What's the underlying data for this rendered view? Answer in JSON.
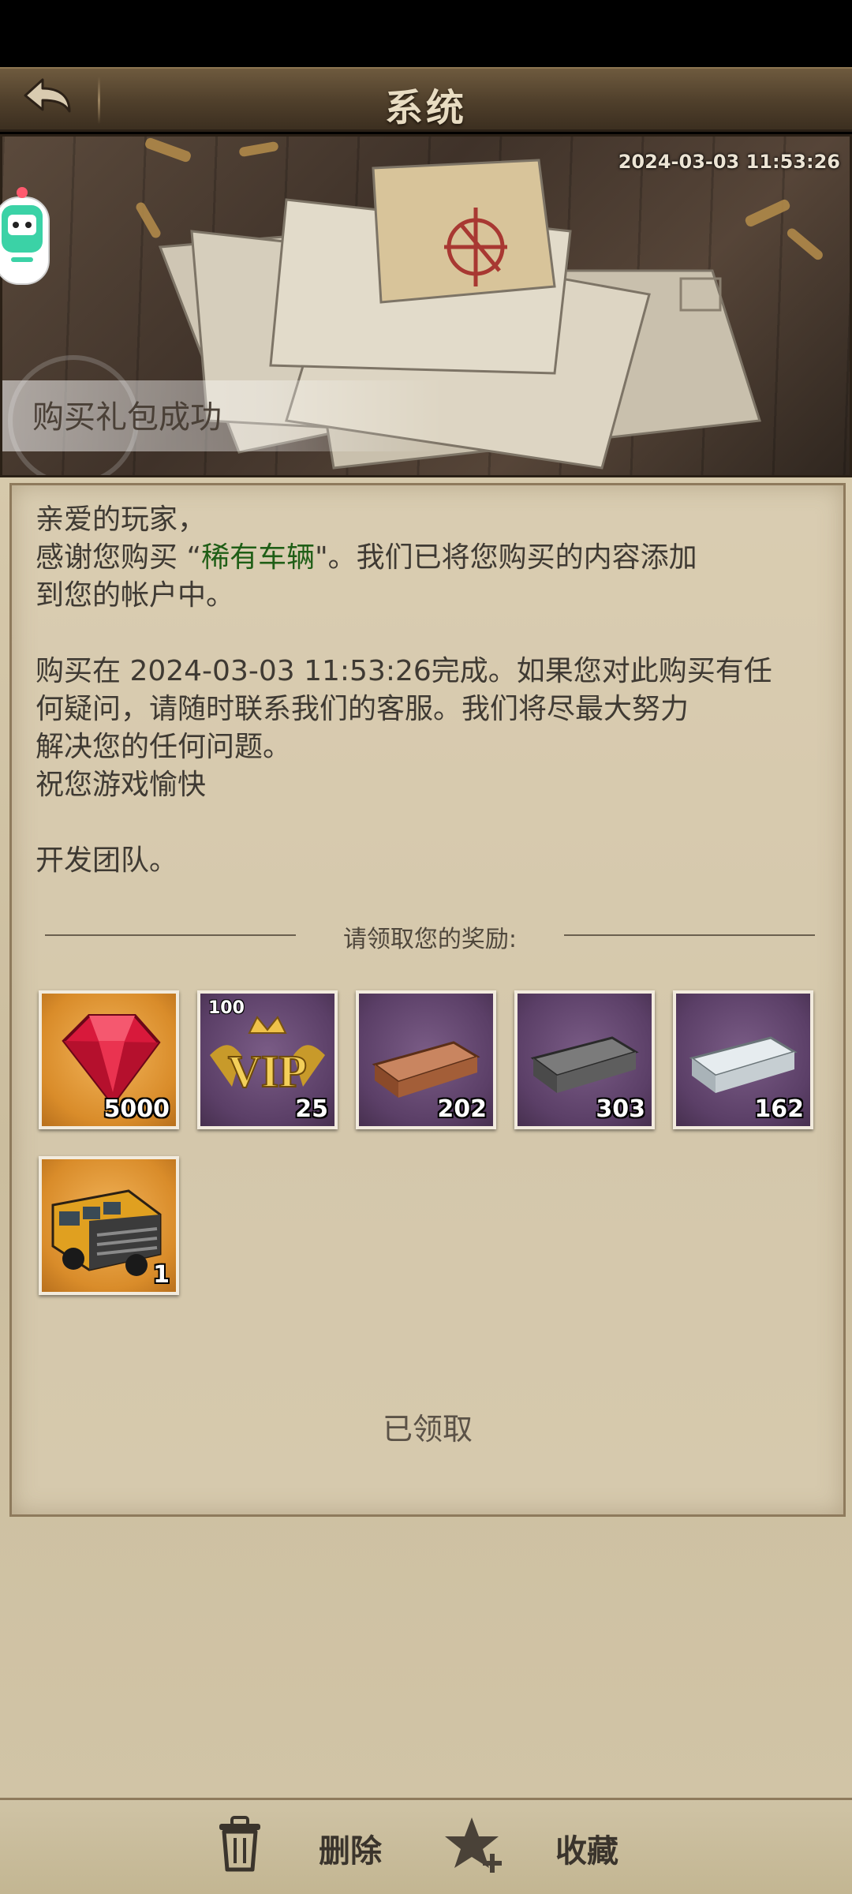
{
  "header": {
    "title": "系统"
  },
  "banner": {
    "timestamp": "2024-03-03 11:53:26",
    "title": "购买礼包成功"
  },
  "letter": {
    "greeting": "亲爱的玩家，",
    "thanks_prefix": "感谢您购买 “",
    "item_name": "稀有车辆",
    "thanks_suffix": "\"。我们已将您购买的内容添加",
    "thanks_line2": "到您的帐户中。",
    "completed_line1": "购买在 2024-03-03 11:53:26完成。如果您对此购买有任",
    "completed_line2": "何疑问，请随时联系我们的客服。我们将尽最大努力",
    "completed_line3": "解决您的任何问题。",
    "wish": "祝您游戏愉快",
    "signature": "开发团队。"
  },
  "rewards": {
    "heading": "请领取您的奖励:",
    "items": [
      {
        "icon": "ruby-gem-icon",
        "quantity": "5000",
        "bg": "gold"
      },
      {
        "icon": "vip-points-icon",
        "tag": "100",
        "badge": "VIP",
        "quantity": "25",
        "bg": "purple"
      },
      {
        "icon": "copper-ingot-icon",
        "quantity": "202",
        "bg": "purple"
      },
      {
        "icon": "iron-ingot-icon",
        "quantity": "303",
        "bg": "purple"
      },
      {
        "icon": "silver-ingot-icon",
        "quantity": "162",
        "bg": "purple"
      },
      {
        "icon": "armored-bus-icon",
        "quantity": "1",
        "bg": "gold"
      }
    ],
    "status": "已领取"
  },
  "actions": {
    "delete_label": "删除",
    "favorite_label": "收藏"
  },
  "colors": {
    "header_bg": "#4f3f2b",
    "paper_bg": "#d1c4a6",
    "highlight_text": "#1f5e16",
    "gold_tile": "#d98c2a",
    "purple_tile": "#5b3f67"
  }
}
